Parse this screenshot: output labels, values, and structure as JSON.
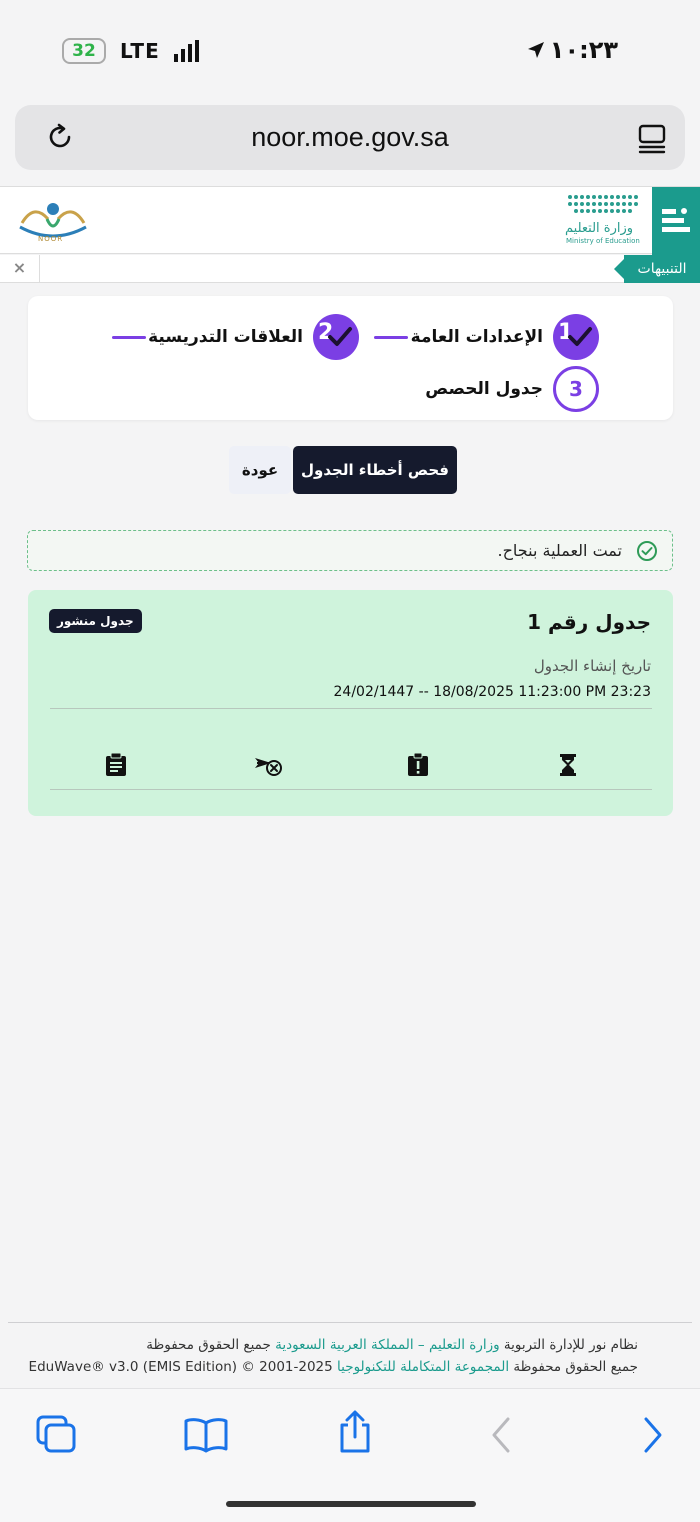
{
  "status_bar": {
    "battery": "32",
    "network": "LTE",
    "time": "١٠:٢٣"
  },
  "browser": {
    "url": "noor.moe.gov.sa"
  },
  "header": {
    "noor_caption": "NOOR",
    "ministry_ar": "وزارة التعليم",
    "ministry_en": "Ministry of Education",
    "notifications_label": "التنبيهات",
    "close_glyph": "×"
  },
  "wizard": {
    "steps": [
      {
        "number": "1",
        "label": "الإعدادات العامة",
        "state": "done"
      },
      {
        "number": "2",
        "label": "العلاقات التدريسية",
        "state": "done"
      },
      {
        "number": "3",
        "label": "جدول الحصص",
        "state": "active"
      }
    ]
  },
  "actions": {
    "check_errors_label": "فحص أخطاء الجدول",
    "back_label": "عودة"
  },
  "alert": {
    "message": "تمت العملية بنجاح."
  },
  "schedule_card": {
    "title": "جدول رقم 1",
    "status_badge": "جدول منشور",
    "created_label": "تاريخ إنشاء الجدول",
    "created_value": "24/02/1447 -- 18/08/2025 11:23:00 PM 23:23",
    "action_icons": [
      "hourglass-icon",
      "alert-clipboard-icon",
      "unpublish-icon",
      "clipboard-list-icon"
    ]
  },
  "footer": {
    "line1_prefix": "نظام نور للإدارة التربوية",
    "line1_link": "وزارة التعليم – المملكة العربية السعودية",
    "line1_suffix": "جميع الحقوق محفوظة",
    "line2_prefix": "جميع الحقوق محفوظة",
    "line2_link": "المجموعة المتكاملة للتكنولوجيا",
    "line2_suffix": "EduWave® v3.0 (EMIS Edition) © 2001-2025"
  },
  "colors": {
    "accent_purple": "#7b3fe4",
    "teal": "#1b9b8d",
    "dark_button": "#151a2d",
    "card_green": "#cff3dc",
    "ios_blue": "#1a73e8"
  }
}
